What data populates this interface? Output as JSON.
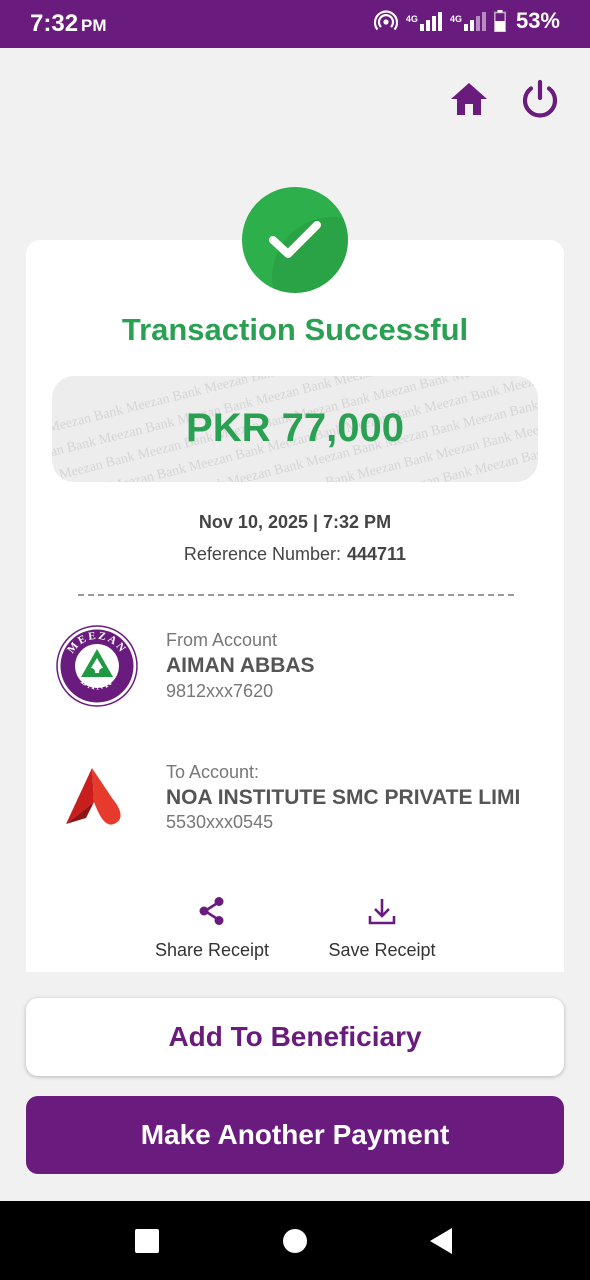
{
  "status_bar": {
    "time": "7:32",
    "ampm": "PM",
    "net1": "4G",
    "net2": "4G",
    "battery": "53%"
  },
  "transaction": {
    "title": "Transaction Successful",
    "amount": "PKR 77,000",
    "datetime": "Nov 10, 2025 | 7:32 PM",
    "reference_label": "Reference Number:",
    "reference_value": "444711",
    "watermark_text": "Meezan Bank"
  },
  "from_account": {
    "label": "From Account",
    "name": "AIMAN ABBAS",
    "number": "9812xxx7620",
    "bank_logo_text": [
      "MEEZAN",
      "BANK"
    ]
  },
  "to_account": {
    "label": "To Account:",
    "name": "NOA INSTITUTE SMC PRIVATE LIMI",
    "number": "5530xxx0545"
  },
  "actions": {
    "share_label": "Share Receipt",
    "save_label": "Save Receipt"
  },
  "buttons": {
    "add_beneficiary": "Add To Beneficiary",
    "make_another_payment": "Make Another Payment"
  },
  "colors": {
    "brand_purple": "#6a1b7e",
    "success_green": "#2db04b",
    "amount_green": "#2aa052"
  }
}
